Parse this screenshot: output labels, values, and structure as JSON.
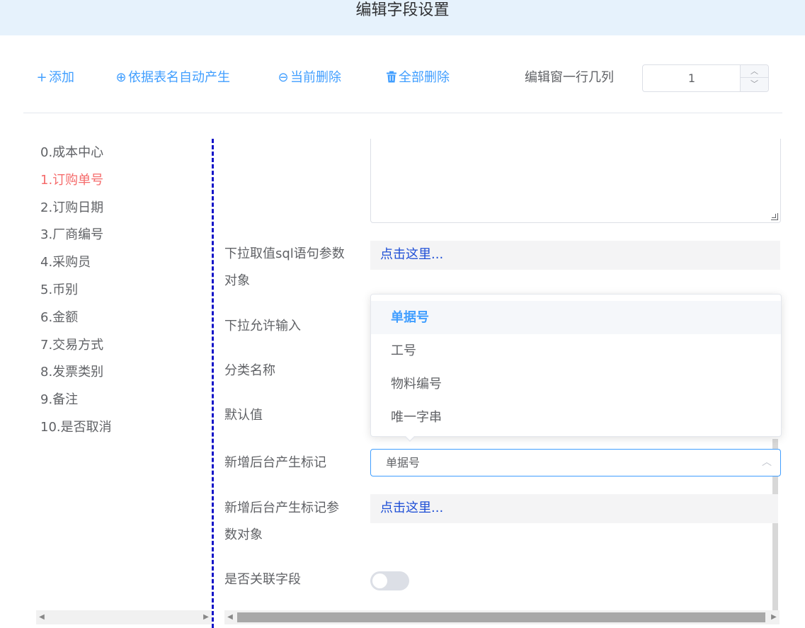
{
  "header": {
    "title": "编辑字段设置"
  },
  "toolbar": {
    "add": {
      "icon": "+",
      "label": "添加"
    },
    "auto_generate": {
      "icon": "⊕",
      "label": "依据表名自动产生"
    },
    "delete_current": {
      "icon": "⊖",
      "label": "当前删除"
    },
    "delete_all": {
      "icon": "trash",
      "label": "全部删除"
    },
    "columns_label": "编辑窗一行几列",
    "columns_value": "1"
  },
  "fields": [
    {
      "label": "0.成本中心"
    },
    {
      "label": "1.订购单号",
      "active": true
    },
    {
      "label": "2.订购日期"
    },
    {
      "label": "3.厂商编号"
    },
    {
      "label": "4.采购员"
    },
    {
      "label": "5.币别"
    },
    {
      "label": "6.金额"
    },
    {
      "label": "7.交易方式"
    },
    {
      "label": "8.发票类别"
    },
    {
      "label": "9.备注"
    },
    {
      "label": "10.是否取消"
    }
  ],
  "form": {
    "sql_param_label_line1": "下拉取值sql语句参数",
    "sql_param_label_line2": "对象",
    "sql_param_link": "点击这里...",
    "allow_input_label": "下拉允许输入",
    "category_label": "分类名称",
    "default_label": "默认值",
    "backend_tag_label": "新增后台产生标记",
    "backend_tag_value": "单据号",
    "backend_param_label_line1": "新增后台产生标记参",
    "backend_param_label_line2": "数对象",
    "backend_param_link": "点击这里...",
    "linked_field_label": "是否关联字段",
    "linked_field_on": false
  },
  "dropdown": {
    "options": [
      "单据号",
      "工号",
      "物料编号",
      "唯一字串"
    ],
    "selected_index": 0
  },
  "colors": {
    "accent": "#409eff",
    "active_field": "#f56c6c",
    "link": "#1f4fd6",
    "separator": "#1414c8",
    "header_bg": "#e6f2fc"
  }
}
